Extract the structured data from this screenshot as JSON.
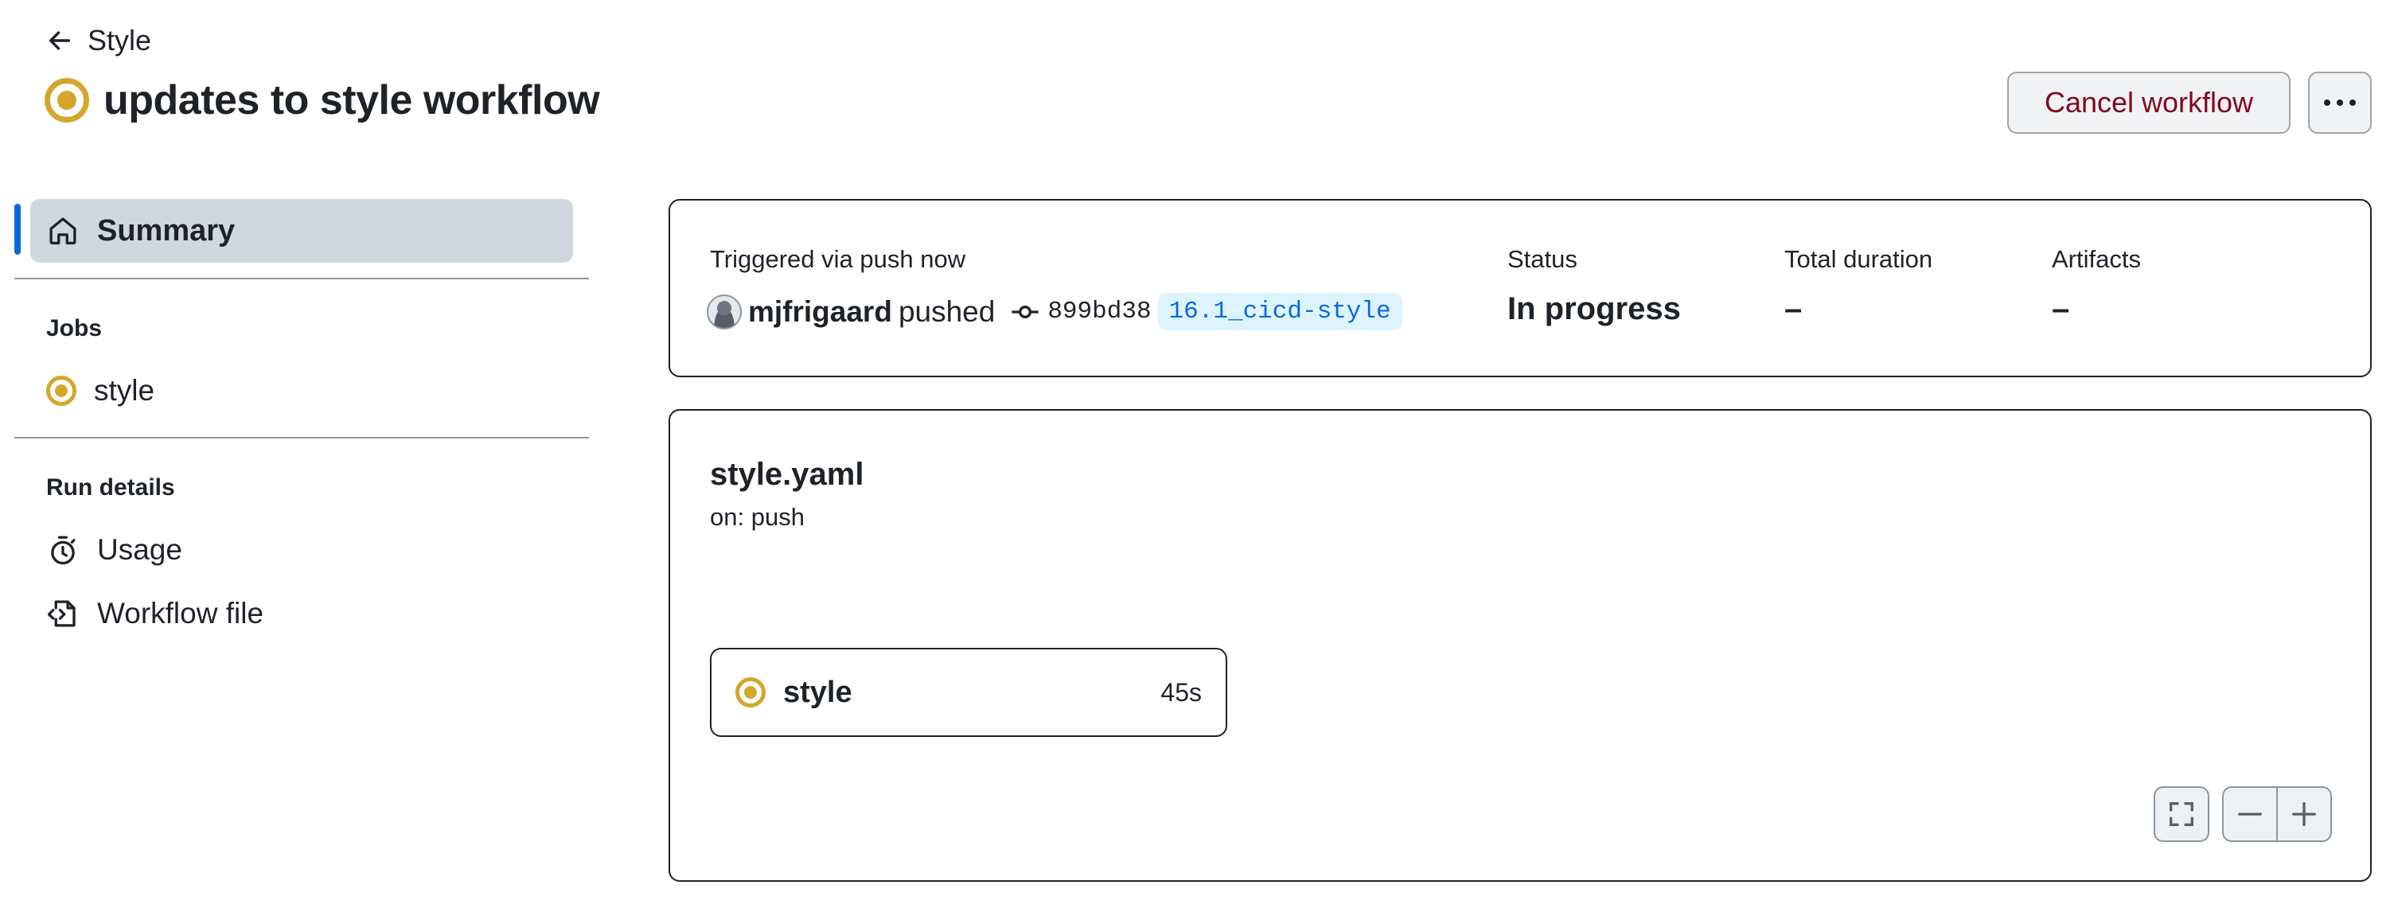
{
  "header": {
    "back_label": "Style",
    "title": "updates to style workflow",
    "cancel_label": "Cancel workflow"
  },
  "sidebar": {
    "summary_label": "Summary",
    "jobs_heading": "Jobs",
    "jobs": [
      {
        "label": "style",
        "status": "in_progress"
      }
    ],
    "run_details_heading": "Run details",
    "run_details": [
      {
        "label": "Usage",
        "icon": "stopwatch-icon"
      },
      {
        "label": "Workflow file",
        "icon": "file-code-icon"
      }
    ]
  },
  "run_summary": {
    "trigger_text": "Triggered via push now",
    "actor": "mjfrigaard",
    "action": "pushed",
    "commit_sha": "899bd38",
    "branch": "16.1_cicd-style",
    "status_label": "Status",
    "status_value": "In progress",
    "duration_label": "Total duration",
    "duration_value": "–",
    "artifacts_label": "Artifacts",
    "artifacts_value": "–"
  },
  "workflow_graph": {
    "file_name": "style.yaml",
    "trigger": "on: push",
    "job": {
      "name": "style",
      "duration": "45s",
      "status": "in_progress"
    }
  },
  "colors": {
    "in_progress": "#d4a72c",
    "accent": "#0969da",
    "danger_text": "#82071e"
  }
}
